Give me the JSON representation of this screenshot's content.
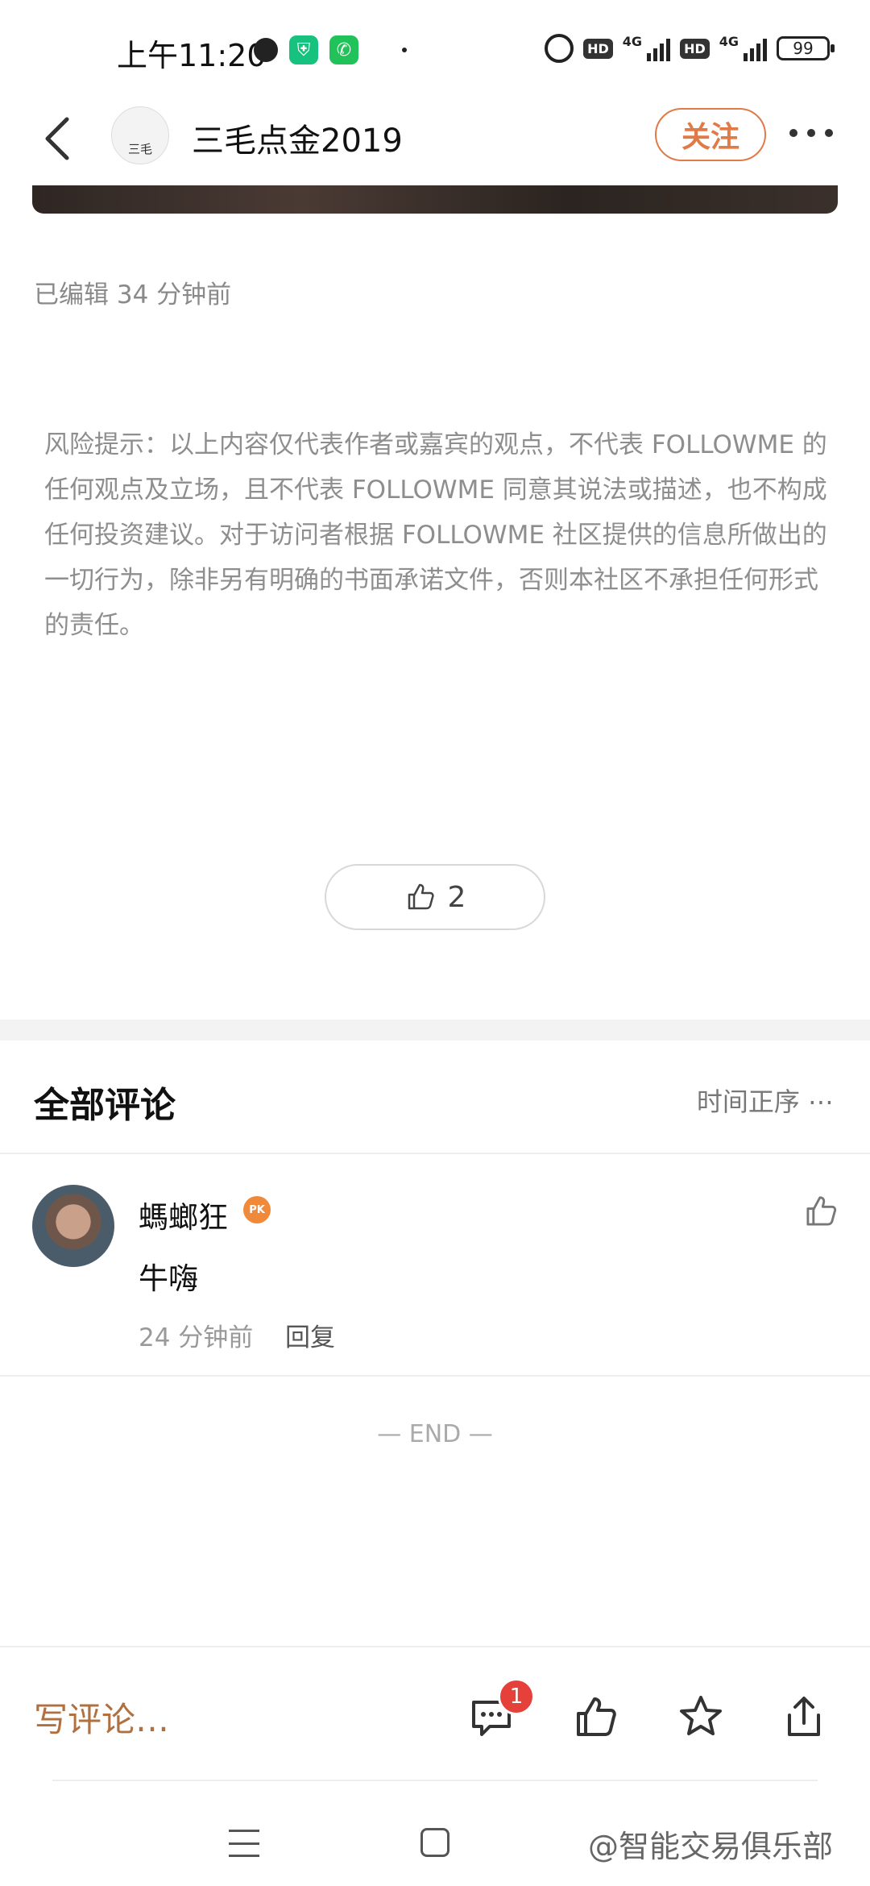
{
  "status_bar": {
    "time": "上午11:20",
    "network_1": "4G",
    "network_2": "4G",
    "hd_label": "HD",
    "battery": "99"
  },
  "header": {
    "author_name": "三毛点金2019",
    "avatar_text": "三毛",
    "follow_label": "关注"
  },
  "post": {
    "edited_time": "已编辑 34 分钟前",
    "risk_notice": "风险提示：以上内容仅代表作者或嘉宾的观点，不代表 FOLLOWME 的任何观点及立场，且不代表 FOLLOWME 同意其说法或描述，也不构成任何投资建议。对于访问者根据 FOLLOWME 社区提供的信息所做出的一切行为，除非另有明确的书面承诺文件，否则本社区不承担任何形式的责任。",
    "like_count": "2"
  },
  "comments": {
    "title": "全部评论",
    "sort_label": "时间正序",
    "items": [
      {
        "user": "螞螂狂",
        "badge": "PK",
        "text": "牛嗨",
        "time": "24 分钟前",
        "reply_label": "回复"
      }
    ],
    "end_label": "— END —"
  },
  "action_bar": {
    "write_placeholder": "写评论…",
    "comment_badge": "1"
  },
  "watermark": "@智能交易俱乐部",
  "colors": {
    "accent": "#e07a47",
    "write_comment": "#b0703f",
    "badge": "#e6403a"
  }
}
